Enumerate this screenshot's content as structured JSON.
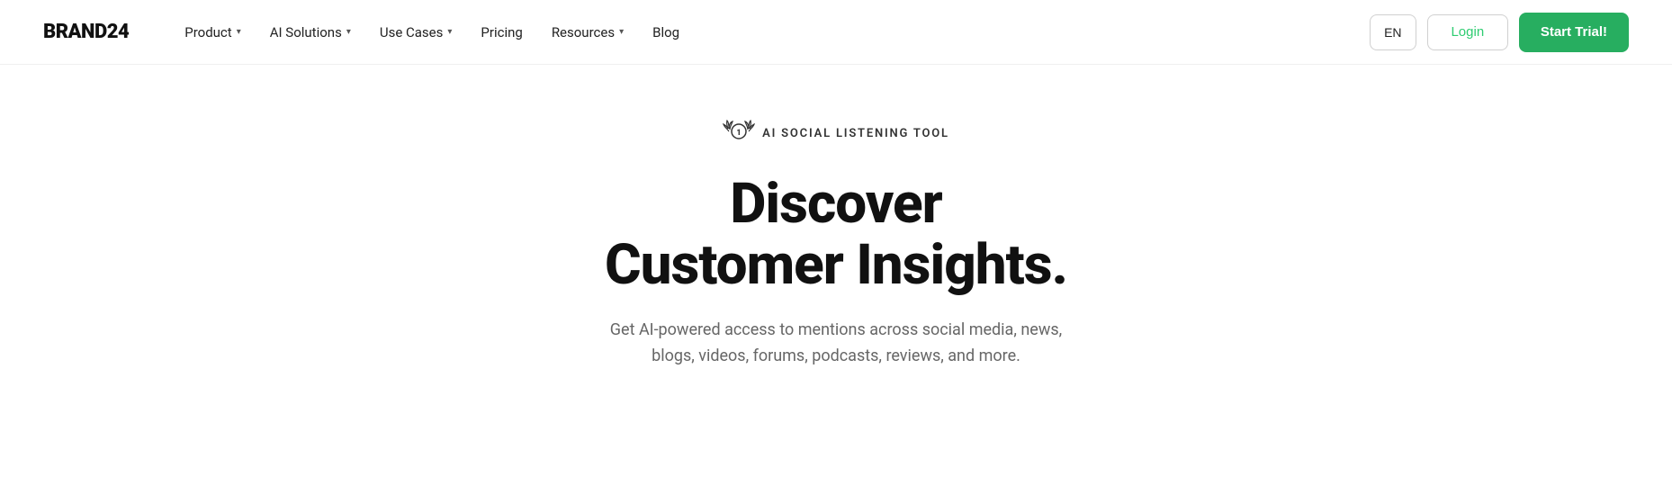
{
  "brand": {
    "logo": "BRAND24"
  },
  "nav": {
    "items": [
      {
        "label": "Product",
        "hasDropdown": true
      },
      {
        "label": "AI Solutions",
        "hasDropdown": true
      },
      {
        "label": "Use Cases",
        "hasDropdown": true
      },
      {
        "label": "Pricing",
        "hasDropdown": false
      },
      {
        "label": "Resources",
        "hasDropdown": true
      },
      {
        "label": "Blog",
        "hasDropdown": false
      }
    ],
    "lang": "EN",
    "login_label": "Login",
    "start_trial_label": "Start Trial!"
  },
  "hero": {
    "badge_icon": "🏆",
    "badge_text": "AI SOCIAL LISTENING TOOL",
    "title_line1": "Discover",
    "title_line2": "Customer Insights.",
    "subtitle": "Get AI-powered access to mentions across social media, news, blogs, videos, forums, podcasts, reviews, and more."
  },
  "colors": {
    "green": "#27ae60",
    "login_green": "#2ecc71"
  }
}
